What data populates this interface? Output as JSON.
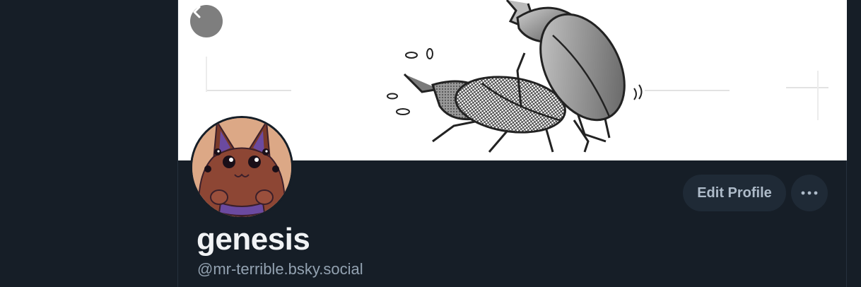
{
  "profile": {
    "display_name": "genesis",
    "handle": "@mr-terrible.bsky.social"
  },
  "actions": {
    "edit_profile_label": "Edit Profile",
    "more_icon": "ellipsis-icon",
    "back_icon": "chevron-left-icon"
  },
  "colors": {
    "background": "#161e27",
    "button_bg": "#1f2a36",
    "button_text": "#aebbc9",
    "name_text": "#f1f3f5",
    "handle_text": "#93a2b1"
  }
}
